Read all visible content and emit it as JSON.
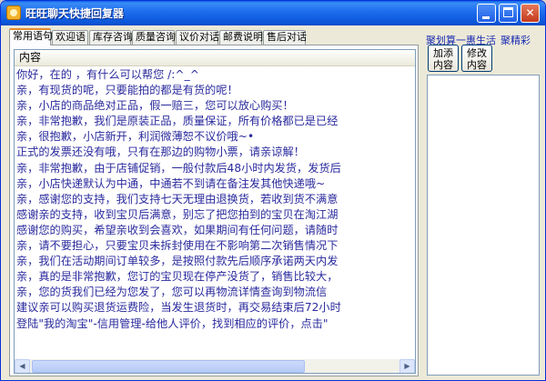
{
  "window": {
    "title": "旺旺聊天快捷回复器"
  },
  "tabs": [
    {
      "label": "常用语句"
    },
    {
      "label": "欢迎语"
    },
    {
      "label": "库存咨询"
    },
    {
      "label": "质量咨询"
    },
    {
      "label": "议价对话"
    },
    {
      "label": "邮费说明"
    },
    {
      "label": "售后对话"
    }
  ],
  "list": {
    "header": "内容",
    "rows": [
      "你好，在的 ，有什么可以帮您 /:^_^",
      "亲，有现货的呢，只要能拍的都是有货的呢！",
      "亲，小店的商品绝对正品，假一赔三，您可以放心购买！",
      "亲，非常抱歉，我们是原装正品，质量保证，所有价格都已是已经",
      "亲，很抱歉，小店新开，利润微薄恕不议价哦~•",
      "正式的发票还没有哦，只有在那边的购物小票，请亲谅解！",
      "亲，非常抱歉，由于店铺促销，一般付款后48小时内发货，发货后",
      "亲，小店快递默认为中通，中通若不到请在备注发其他快递哦~",
      "亲，感谢您的支持，我们支持七天无理由退换货，若收到货不满意",
      "感谢亲的支持，收到宝贝后满意，别忘了把您拍到的宝贝在淘江湖",
      "感谢您的购买，希望亲收到会喜欢，如果期间有任何问题，请随时",
      "亲，请不要担心，只要宝贝未拆封使用在不影响第二次销售情况下",
      "亲，我们在活动期间订单较多，是按照付款先后顺序承诺两天内发",
      "亲，真的是非常抱歉，您订的宝贝现在停产没货了，销售比较大，",
      "亲，您的货我们已经为您发了，您可以再物流详情查询到物流信",
      "建议亲可以购买退货运费险，当发生退货时，再交易结束后72小时",
      "登陆\"我的淘宝\"-信用管理-给他人评价，找到相应的评价，点击\""
    ]
  },
  "sidebar": {
    "link1": "聚划算一惠生活",
    "link2": "聚精彩",
    "add_button": "加添内容",
    "edit_button": "修改内容"
  }
}
